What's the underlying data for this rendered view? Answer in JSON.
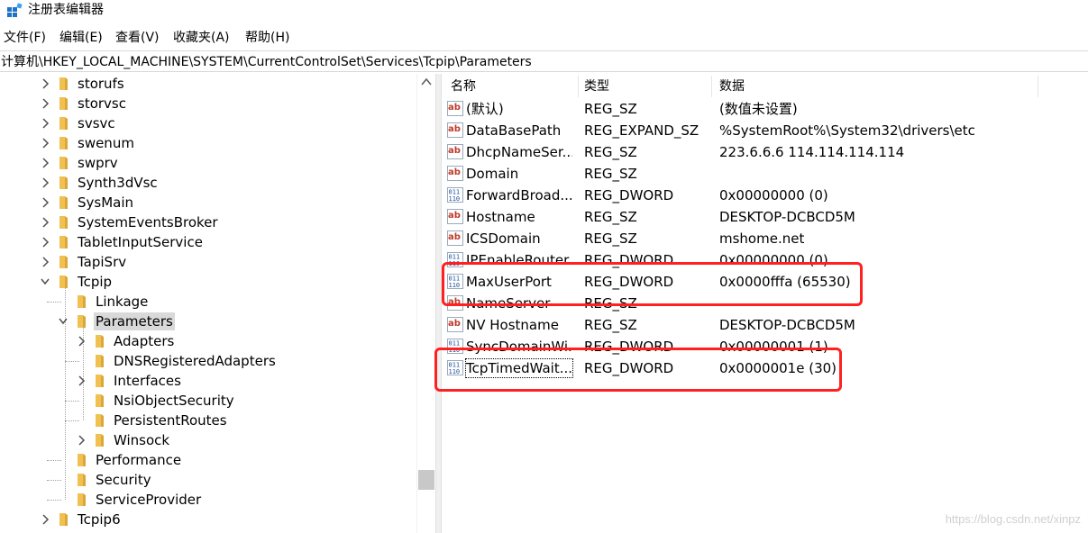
{
  "window": {
    "title": "注册表编辑器"
  },
  "menu": [
    "文件(F)",
    "编辑(E)",
    "查看(V)",
    "收藏夹(A)",
    "帮助(H)"
  ],
  "address": "计算机\\HKEY_LOCAL_MACHINE\\SYSTEM\\CurrentControlSet\\Services\\Tcpip\\Parameters",
  "tree": [
    {
      "label": "storufs",
      "level": 0,
      "expander": "collapsed"
    },
    {
      "label": "storvsc",
      "level": 0,
      "expander": "collapsed"
    },
    {
      "label": "svsvc",
      "level": 0,
      "expander": "collapsed"
    },
    {
      "label": "swenum",
      "level": 0,
      "expander": "collapsed"
    },
    {
      "label": "swprv",
      "level": 0,
      "expander": "collapsed"
    },
    {
      "label": "Synth3dVsc",
      "level": 0,
      "expander": "collapsed"
    },
    {
      "label": "SysMain",
      "level": 0,
      "expander": "collapsed"
    },
    {
      "label": "SystemEventsBroker",
      "level": 0,
      "expander": "collapsed"
    },
    {
      "label": "TabletInputService",
      "level": 0,
      "expander": "collapsed"
    },
    {
      "label": "TapiSrv",
      "level": 0,
      "expander": "collapsed"
    },
    {
      "label": "Tcpip",
      "level": 0,
      "expander": "expanded"
    },
    {
      "label": "Linkage",
      "level": 1,
      "expander": "none"
    },
    {
      "label": "Parameters",
      "level": 1,
      "expander": "expanded",
      "selected": true
    },
    {
      "label": "Adapters",
      "level": 2,
      "expander": "collapsed"
    },
    {
      "label": "DNSRegisteredAdapters",
      "level": 2,
      "expander": "none"
    },
    {
      "label": "Interfaces",
      "level": 2,
      "expander": "collapsed"
    },
    {
      "label": "NsiObjectSecurity",
      "level": 2,
      "expander": "none"
    },
    {
      "label": "PersistentRoutes",
      "level": 2,
      "expander": "none"
    },
    {
      "label": "Winsock",
      "level": 2,
      "expander": "collapsed"
    },
    {
      "label": "Performance",
      "level": 1,
      "expander": "none"
    },
    {
      "label": "Security",
      "level": 1,
      "expander": "none"
    },
    {
      "label": "ServiceProvider",
      "level": 1,
      "expander": "none"
    },
    {
      "label": "Tcpip6",
      "level": 0,
      "expander": "collapsed"
    }
  ],
  "list": {
    "headers": {
      "name": "名称",
      "type": "类型",
      "data": "数据"
    },
    "rows": [
      {
        "icon": "string-value-icon",
        "name": "(默认)",
        "type": "REG_SZ",
        "data": "(数值未设置)"
      },
      {
        "icon": "string-value-icon",
        "name": "DataBasePath",
        "type": "REG_EXPAND_SZ",
        "data": "%SystemRoot%\\System32\\drivers\\etc"
      },
      {
        "icon": "string-value-icon",
        "name": "DhcpNameSer...",
        "type": "REG_SZ",
        "data": "223.6.6.6 114.114.114.114"
      },
      {
        "icon": "string-value-icon",
        "name": "Domain",
        "type": "REG_SZ",
        "data": ""
      },
      {
        "icon": "binary-value-icon",
        "name": "ForwardBroad...",
        "type": "REG_DWORD",
        "data": "0x00000000 (0)"
      },
      {
        "icon": "string-value-icon",
        "name": "Hostname",
        "type": "REG_SZ",
        "data": "DESKTOP-DCBCD5M"
      },
      {
        "icon": "string-value-icon",
        "name": "ICSDomain",
        "type": "REG_SZ",
        "data": "mshome.net"
      },
      {
        "icon": "binary-value-icon",
        "name": "IPEnableRouter",
        "type": "REG_DWORD",
        "data": "0x00000000 (0)"
      },
      {
        "icon": "binary-value-icon",
        "name": "MaxUserPort",
        "type": "REG_DWORD",
        "data": "0x0000fffa (65530)"
      },
      {
        "icon": "string-value-icon",
        "name": "NameServer",
        "type": "REG_SZ",
        "data": ""
      },
      {
        "icon": "string-value-icon",
        "name": "NV Hostname",
        "type": "REG_SZ",
        "data": "DESKTOP-DCBCD5M"
      },
      {
        "icon": "binary-value-icon",
        "name": "SyncDomainWi...",
        "type": "REG_DWORD",
        "data": "0x00000001 (1)"
      },
      {
        "icon": "binary-value-icon",
        "name": "TcpTimedWait...",
        "type": "REG_DWORD",
        "data": "0x0000001e (30)",
        "focused": true
      }
    ]
  },
  "watermark": "https://blog.csdn.net/xinpz",
  "colors": {
    "annotation": "#ff2020",
    "folder": "#f0c050",
    "selection": "#d9d9d9"
  }
}
